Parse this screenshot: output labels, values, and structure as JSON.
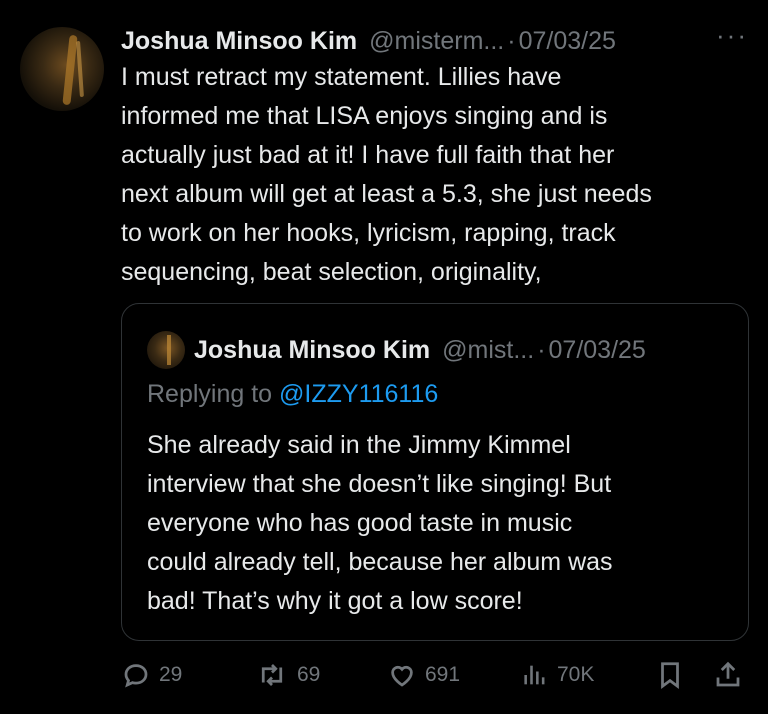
{
  "tweet": {
    "author": {
      "name": "Joshua Minsoo Kim",
      "handle": "@misterm...",
      "date": "07/03/25"
    },
    "more_label": "···",
    "text_lines": [
      "I must retract my statement. Lillies have",
      "informed me that LISA enjoys singing and is",
      "actually just bad at it! I have full faith that her",
      "next album will get at least a 5.3, she just needs",
      "to work on her hooks, lyricism, rapping, track",
      "sequencing, beat selection, originality,"
    ]
  },
  "quote": {
    "author": {
      "name": "Joshua Minsoo Kim",
      "handle": "@mist...",
      "date": "07/03/25"
    },
    "reply_prefix": "Replying to",
    "reply_mention": "@IZZY116116",
    "text_lines": [
      "She already said in the Jimmy Kimmel",
      "interview that she doesn’t like singing! But",
      "everyone who has good taste in music",
      "could already tell, because her album was",
      "bad! That’s why it got a low score!"
    ]
  },
  "actions": {
    "replies": "29",
    "reposts": "69",
    "likes": "691",
    "views": "70K"
  },
  "icons": {
    "reply": "reply-icon",
    "repost": "repost-icon",
    "like": "heart-icon",
    "views": "views-icon",
    "bookmark": "bookmark-icon",
    "share": "share-icon"
  },
  "colors": {
    "background": "#000000",
    "text": "#e7e9ea",
    "muted": "#71767b",
    "link": "#1d9bf0",
    "border": "#2f3336"
  }
}
